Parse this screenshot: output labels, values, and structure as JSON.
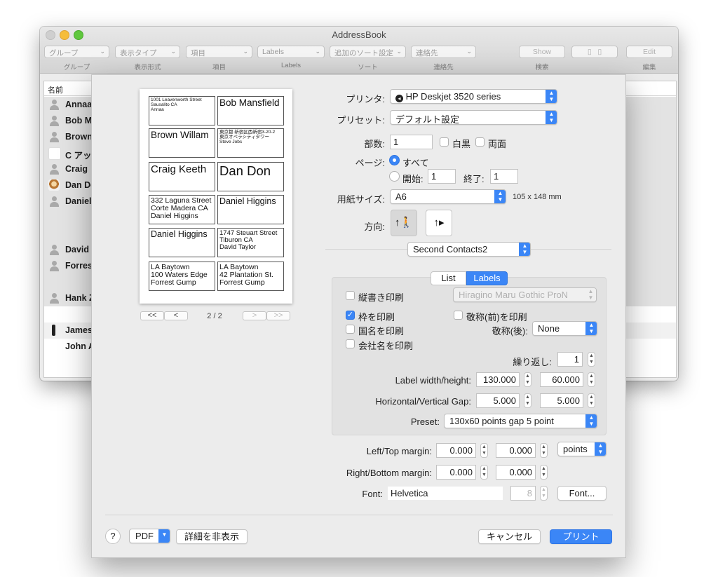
{
  "bg_window": {
    "title": "AddressBook",
    "toolbar": [
      {
        "value": "グループ",
        "label": "グループ"
      },
      {
        "value": "表示タイプ",
        "label": "表示形式"
      },
      {
        "value": "項目",
        "label": "項目"
      },
      {
        "value": "Labels",
        "label": "Labels"
      },
      {
        "value": "追加のソート設定",
        "label": "ソート"
      },
      {
        "value": "連絡先",
        "label": "連絡先"
      }
    ],
    "show_button": "Show",
    "search_label": "検索",
    "edit_button": "Edit",
    "edit_label": "編集",
    "list_header": "名前",
    "rows": [
      "Annaa",
      "Bob M",
      "Brown",
      "C アップ",
      "Craig",
      "Dan De",
      "Daniel",
      "",
      "",
      "David",
      "Forres",
      "",
      "Hank Z",
      "",
      "James",
      "John A"
    ]
  },
  "preview": {
    "labels": [
      {
        "lines": [
          "1001  Leavenworth Street",
          "Sausalito CA",
          "Annaa"
        ]
      },
      {
        "lines": [
          "Bob Mansfield"
        ]
      },
      {
        "lines": [
          "Brown Willam"
        ]
      },
      {
        "lines": [
          "東京都 新宿区西新宿3-20-2",
          "東京オペラシティタワー",
          "Steve Jobs"
        ]
      },
      {
        "lines": [
          "Craig Keeth"
        ]
      },
      {
        "lines": [
          "Dan Don"
        ]
      },
      {
        "lines": [
          "332 Laguna Street",
          "Corte Madera CA",
          "Daniel Higgins"
        ]
      },
      {
        "lines": [
          "Daniel Higgins"
        ]
      },
      {
        "lines": [
          "Daniel Higgins"
        ]
      },
      {
        "lines": [
          "1747 Steuart Street",
          "Tiburon CA",
          "David Taylor"
        ]
      },
      {
        "lines": [
          "LA Baytown",
          "100 Waters Edge",
          "Forrest Gump"
        ]
      },
      {
        "lines": [
          "LA Baytown",
          "42 Plantation St.",
          "Forrest Gump"
        ]
      }
    ],
    "pager": {
      "first": "<<",
      "prev": "<",
      "next": ">",
      "last": ">>",
      "page": "2 / 2"
    }
  },
  "print": {
    "printer_label": "プリンタ:",
    "printer_value": "HP Deskjet 3520 series",
    "preset_label": "プリセット:",
    "preset_value": "デフォルト設定",
    "copies_label": "部数:",
    "copies_value": "1",
    "bw_label": "白黒",
    "duplex_label": "両面",
    "pages_label": "ページ:",
    "all_label": "すべて",
    "from_label": "開始:",
    "from_value": "1",
    "to_label": "終了:",
    "to_value": "1",
    "paper_label": "用紙サイズ:",
    "paper_value": "A6",
    "paper_dims": "105 x 148 mm",
    "orientation_label": "方向:",
    "contacts_popup": "Second Contacts2",
    "tab_list": "List",
    "tab_labels": "Labels"
  },
  "labels_pane": {
    "vertical_label": "縦書き印刷",
    "font_family_value": "Hiragino Maru Gothic ProN",
    "border_label": "枠を印刷",
    "honorific_pre_label": "敬称(前)を印刷",
    "country_label": "国名を印刷",
    "honorific_post_label": "敬称(後):",
    "honorific_post_value": "None",
    "company_label": "会社名を印刷",
    "repeat_label": "繰り返し:",
    "repeat_value": "1",
    "size_label": "Label width/height:",
    "width_value": "130.000",
    "height_value": "60.000",
    "gap_label": "Horizontal/Vertical Gap:",
    "hgap_value": "5.000",
    "vgap_value": "5.000",
    "preset_label": "Preset:",
    "preset_value": "130x60 points gap 5 point"
  },
  "margins": {
    "lefttop_label": "Left/Top margin:",
    "left_value": "0.000",
    "top_value": "0.000",
    "unit_value": "points",
    "rightbottom_label": "Right/Bottom margin:",
    "right_value": "0.000",
    "bottom_value": "0.000",
    "font_label": "Font:",
    "font_value": "Helvetica",
    "font_size_value": "8",
    "font_button": "Font..."
  },
  "footer": {
    "help": "?",
    "pdf": "PDF",
    "hide_details": "詳細を非表示",
    "cancel": "キャンセル",
    "print": "プリント"
  }
}
